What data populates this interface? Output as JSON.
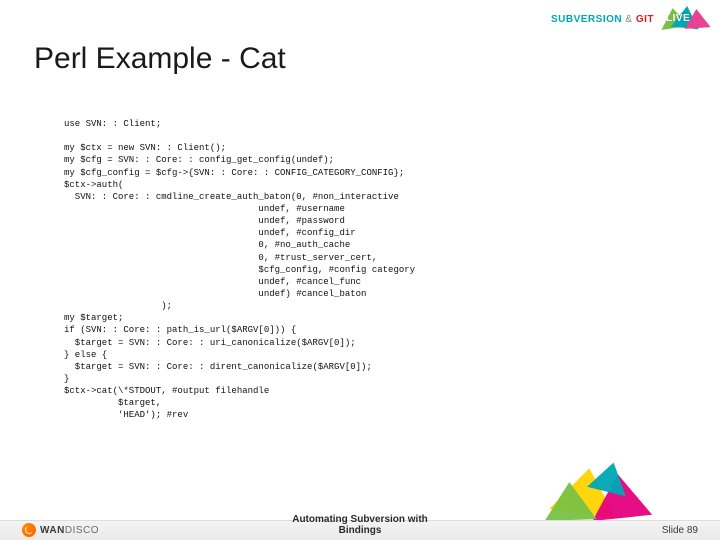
{
  "header": {
    "brand_sub": "SUBVERSION",
    "brand_amp": "&",
    "brand_git": "GIT",
    "live": "LIVE"
  },
  "title": "Perl Example - Cat",
  "code_lines": [
    "use SVN: : Client;",
    "",
    "my $ctx = new SVN: : Client();",
    "my $cfg = SVN: : Core: : config_get_config(undef);",
    "my $cfg_config = $cfg->{SVN: : Core: : CONFIG_CATEGORY_CONFIG};",
    "$ctx->auth(",
    "  SVN: : Core: : cmdline_create_auth_baton(0, #non_interactive",
    "                                    undef, #username",
    "                                    undef, #password",
    "                                    undef, #config_dir",
    "                                    0, #no_auth_cache",
    "                                    0, #trust_server_cert,",
    "                                    $cfg_config, #config category",
    "                                    undef, #cancel_func",
    "                                    undef) #cancel_baton",
    "                  );",
    "my $target;",
    "if (SVN: : Core: : path_is_url($ARGV[0])) {",
    "  $target = SVN: : Core: : uri_canonicalize($ARGV[0]);",
    "} else {",
    "  $target = SVN: : Core: : dirent_canonicalize($ARGV[0]);",
    "}",
    "$ctx->cat(\\*STDOUT, #output filehandle",
    "          $target,",
    "          'HEAD'); #rev"
  ],
  "footer": {
    "logo_bold": "WAN",
    "logo_rest": "DISCO",
    "caption_line1": "Automating Subversion with",
    "caption_line2": "Bindings",
    "slide_label": "Slide 89"
  }
}
